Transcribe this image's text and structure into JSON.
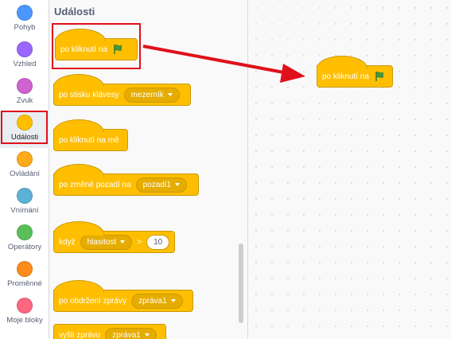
{
  "categories": [
    {
      "label": "Pohyb",
      "color": "#4c97ff"
    },
    {
      "label": "Vzhled",
      "color": "#9966ff"
    },
    {
      "label": "Zvuk",
      "color": "#cf63cf"
    },
    {
      "label": "Události",
      "color": "#ffbf00",
      "selected": true
    },
    {
      "label": "Ovládání",
      "color": "#ffab19"
    },
    {
      "label": "Vnímání",
      "color": "#5cb1d6"
    },
    {
      "label": "Operátory",
      "color": "#59c059"
    },
    {
      "label": "Proměnné",
      "color": "#ff8c1a"
    },
    {
      "label": "Moje bloky",
      "color": "#ff6680"
    }
  ],
  "palette": {
    "title": "Události",
    "blocks": {
      "when_flag": "po kliknutí na",
      "when_key": "po stisku klávesy",
      "when_key_value": "mezerník",
      "when_sprite": "po kliknutí na mě",
      "when_backdrop": "po změně pozadí na",
      "when_backdrop_value": "pozadí1",
      "when_gt": "když",
      "when_gt_value": "hlasitost",
      "when_gt_op": ">",
      "when_gt_num": "10",
      "when_receive": "po obdržení zprávy",
      "when_receive_value": "zpráva1",
      "broadcast": "vyšli zprávu",
      "broadcast_value": "zpráva1"
    }
  },
  "workspace": {
    "block_label": "po kliknutí na"
  },
  "colors": {
    "event": "#ffbf00",
    "highlight": "#e0101a",
    "flag": "#45993d"
  }
}
